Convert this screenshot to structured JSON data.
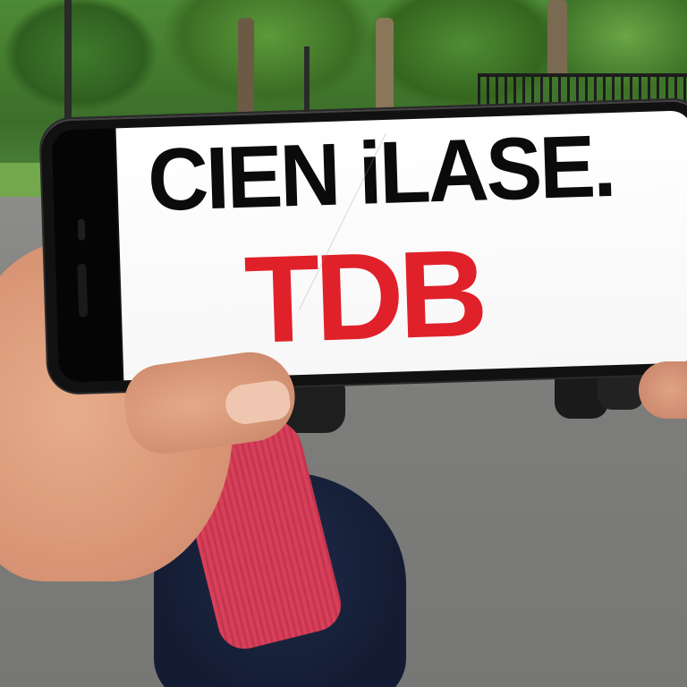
{
  "phone_screen": {
    "headline": "CIEN iLASE.",
    "brand": "TDB"
  },
  "colors": {
    "headline": "#0b0b0b",
    "brand": "#e0212a",
    "screen_background": "#ffffff",
    "phone_body": "#111111"
  }
}
